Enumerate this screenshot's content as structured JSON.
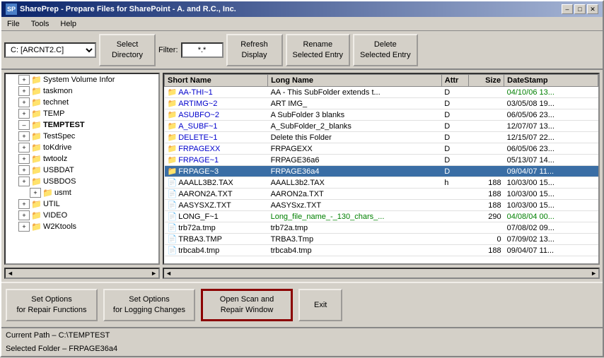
{
  "window": {
    "title": "SharePrep - Prepare Files for SharePoint - A. and R.C., Inc.",
    "icon": "SP"
  },
  "title_buttons": {
    "minimize": "–",
    "maximize": "□",
    "close": "✕"
  },
  "menu": {
    "items": [
      "File",
      "Tools",
      "Help"
    ]
  },
  "toolbar": {
    "drive_label": "C: [ARCNT2.C]",
    "filter_label": "Filter:",
    "filter_value": "*.*",
    "select_directory": "Select\nDirectory",
    "refresh_display": "Refresh\nDisplay",
    "rename_entry": "Rename\nSelected Entry",
    "delete_entry": "Delete\nSelected Entry"
  },
  "tree": {
    "items": [
      {
        "indent": 1,
        "label": "System Volume Infor",
        "has_expand": true,
        "expanded": false
      },
      {
        "indent": 1,
        "label": "taskmon",
        "has_expand": true,
        "expanded": false
      },
      {
        "indent": 1,
        "label": "technet",
        "has_expand": true,
        "expanded": false
      },
      {
        "indent": 1,
        "label": "TEMP",
        "has_expand": true,
        "expanded": false
      },
      {
        "indent": 1,
        "label": "TEMPTEST",
        "has_expand": true,
        "expanded": true,
        "selected": true
      },
      {
        "indent": 1,
        "label": "TestSpec",
        "has_expand": true,
        "expanded": false
      },
      {
        "indent": 1,
        "label": "toKdrive",
        "has_expand": true,
        "expanded": false
      },
      {
        "indent": 1,
        "label": "twtoolz",
        "has_expand": true,
        "expanded": false
      },
      {
        "indent": 1,
        "label": "USBDAT",
        "has_expand": true,
        "expanded": false
      },
      {
        "indent": 1,
        "label": "USBDOS",
        "has_expand": true,
        "expanded": false
      },
      {
        "indent": 2,
        "label": "usmt",
        "has_expand": true,
        "expanded": false
      },
      {
        "indent": 1,
        "label": "UTIL",
        "has_expand": true,
        "expanded": false
      },
      {
        "indent": 1,
        "label": "VIDEO",
        "has_expand": true,
        "expanded": false
      },
      {
        "indent": 1,
        "label": "W2Ktools",
        "has_expand": true,
        "expanded": false
      }
    ]
  },
  "files": {
    "columns": [
      "Short Name",
      "Long Name",
      "Attr",
      "Size",
      "DateStamp"
    ],
    "rows": [
      {
        "short": "AA-THI~1",
        "long": "AA - This SubFolder extends t...",
        "attr": "D",
        "size": "",
        "date": "04/10/06 13...",
        "is_folder": true,
        "date_color": "green",
        "long_color": "normal"
      },
      {
        "short": "ARTIMG~2",
        "long": "ART IMG_",
        "attr": "D",
        "size": "",
        "date": "03/05/08 19...",
        "is_folder": true,
        "date_color": "normal",
        "long_color": "normal"
      },
      {
        "short": "ASUBFO~2",
        "long": "A SubFolder 3 blanks",
        "attr": "D",
        "size": "",
        "date": "06/05/06 23...",
        "is_folder": true,
        "date_color": "normal",
        "long_color": "normal"
      },
      {
        "short": "A_SUBF~1",
        "long": "A_SubFolder_2_blanks",
        "attr": "D",
        "size": "",
        "date": "12/07/07 13...",
        "is_folder": true,
        "date_color": "normal",
        "long_color": "normal"
      },
      {
        "short": "DELETE~1",
        "long": "Delete this Folder",
        "attr": "D",
        "size": "",
        "date": "12/15/07 22...",
        "is_folder": true,
        "date_color": "normal",
        "long_color": "normal"
      },
      {
        "short": "FRPAGEXX",
        "long": "FRPAGEXX",
        "attr": "D",
        "size": "",
        "date": "06/05/06 23...",
        "is_folder": true,
        "date_color": "normal",
        "long_color": "normal"
      },
      {
        "short": "FRPAGE~1",
        "long": "FRPAGE36a6",
        "attr": "D",
        "size": "",
        "date": "05/13/07 14...",
        "is_folder": true,
        "date_color": "normal",
        "long_color": "normal"
      },
      {
        "short": "FRPAGE~3",
        "long": "FRPAGE36a4",
        "attr": "D",
        "size": "",
        "date": "09/04/07 11...",
        "is_folder": true,
        "date_color": "green",
        "long_color": "green",
        "selected": true
      },
      {
        "short": "AAALL3B2.TAX",
        "long": "AAALL3b2.TAX",
        "attr": "h",
        "size": "188",
        "date": "10/03/00 15...",
        "is_folder": false,
        "date_color": "normal",
        "long_color": "normal"
      },
      {
        "short": "AARON2A.TXT",
        "long": "AARON2a.TXT",
        "attr": "",
        "size": "188",
        "date": "10/03/00 15...",
        "is_folder": false,
        "date_color": "normal",
        "long_color": "normal"
      },
      {
        "short": "AASYSXZ.TXT",
        "long": "AASYSxz.TXT",
        "attr": "",
        "size": "188",
        "date": "10/03/00 15...",
        "is_folder": false,
        "date_color": "normal",
        "long_color": "normal"
      },
      {
        "short": "LONG_F~1",
        "long": "Long_file_name_-_130_chars_...",
        "attr": "",
        "size": "290",
        "date": "04/08/04 00...",
        "is_folder": false,
        "date_color": "green",
        "long_color": "green"
      },
      {
        "short": "trb72a.tmp",
        "long": "trb72a.tmp",
        "attr": "",
        "size": "",
        "date": "07/08/02 09...",
        "is_folder": false,
        "date_color": "normal",
        "long_color": "normal"
      },
      {
        "short": "TRBA3.TMP",
        "long": "TRBA3.Tmp",
        "attr": "",
        "size": "0",
        "date": "07/09/02 13...",
        "is_folder": false,
        "date_color": "normal",
        "long_color": "normal"
      },
      {
        "short": "trbcab4.tmp",
        "long": "trbcab4.tmp",
        "attr": "",
        "size": "188",
        "date": "09/04/07 11...",
        "is_folder": false,
        "date_color": "normal",
        "long_color": "normal"
      }
    ]
  },
  "bottom_buttons": {
    "repair_options": "Set Options\nfor Repair Functions",
    "logging_options": "Set Options\nfor Logging Changes",
    "scan_repair": "Open Scan and\nRepair Window",
    "exit": "Exit"
  },
  "status": {
    "current_path_label": "Current Path – C:\\TEMPTEST",
    "selected_folder_label": "Selected Folder  –  FRPAGE36a4"
  }
}
